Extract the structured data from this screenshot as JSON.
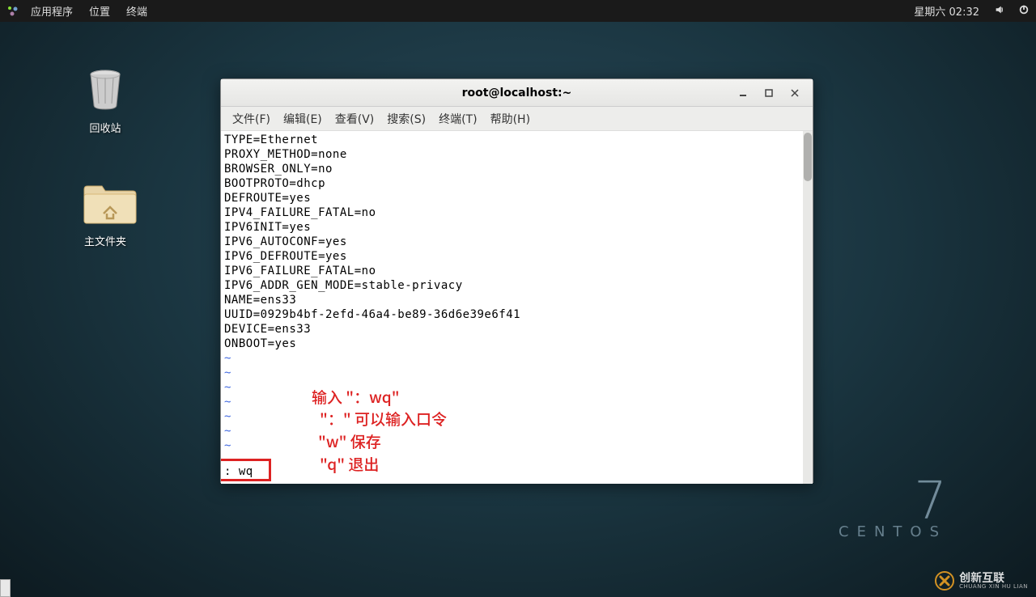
{
  "topbar": {
    "menu": [
      "应用程序",
      "位置",
      "终端"
    ],
    "clock": "星期六 02:32"
  },
  "desktop_icons": {
    "trash": "回收站",
    "home": "主文件夹"
  },
  "window": {
    "title": "root@localhost:~",
    "menu": [
      "文件(F)",
      "编辑(E)",
      "查看(V)",
      "搜索(S)",
      "终端(T)",
      "帮助(H)"
    ]
  },
  "terminal": {
    "lines": [
      "TYPE=Ethernet",
      "PROXY_METHOD=none",
      "BROWSER_ONLY=no",
      "BOOTPROTO=dhcp",
      "DEFROUTE=yes",
      "IPV4_FAILURE_FATAL=no",
      "IPV6INIT=yes",
      "IPV6_AUTOCONF=yes",
      "IPV6_DEFROUTE=yes",
      "IPV6_FAILURE_FATAL=no",
      "IPV6_ADDR_GEN_MODE=stable-privacy",
      "NAME=ens33",
      "UUID=0929b4bf-2efd-46a4-be89-36d6e39e6f41",
      "DEVICE=ens33",
      "ONBOOT=yes"
    ],
    "tildes": [
      "~",
      "~",
      "~",
      "~",
      "~",
      "~",
      "~"
    ],
    "command": ": wq"
  },
  "annotations": {
    "a1": "输入 \"：wq\"",
    "a2": "\"：\" 可以输入口令",
    "a3": "\"w\" 保存",
    "a4": "\"q\" 退出"
  },
  "brand": {
    "version": "7",
    "name": "CENTOS"
  },
  "watermark": {
    "cn": "创新互联",
    "py": "CHUANG XIN HU LIAN"
  }
}
